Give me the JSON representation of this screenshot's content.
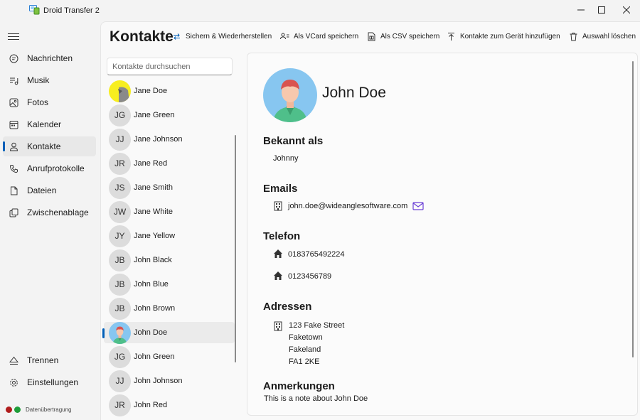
{
  "window": {
    "title": "Droid Transfer 2",
    "controls": [
      "minimize",
      "maximize",
      "close"
    ]
  },
  "nav": {
    "items": [
      {
        "label": "Nachrichten",
        "icon": "message-icon"
      },
      {
        "label": "Musik",
        "icon": "music-icon"
      },
      {
        "label": "Fotos",
        "icon": "photo-icon"
      },
      {
        "label": "Kalender",
        "icon": "calendar-icon"
      },
      {
        "label": "Kontakte",
        "icon": "person-icon",
        "active": true
      },
      {
        "label": "Anrufprotokolle",
        "icon": "phone-icon"
      },
      {
        "label": "Dateien",
        "icon": "file-icon"
      },
      {
        "label": "Zwischenablage",
        "icon": "clipboard-icon"
      }
    ],
    "bottom": [
      {
        "label": "Trennen",
        "icon": "eject-icon"
      },
      {
        "label": "Einstellungen",
        "icon": "gear-icon"
      }
    ],
    "status": {
      "label": "Datenübertragung",
      "colors": [
        "#b01c1c",
        "#1f9d3a"
      ]
    }
  },
  "page": {
    "title": "Kontakte"
  },
  "toolbar": {
    "backup": "Sichern & Wiederherstellen",
    "vcard": "Als VCard speichern",
    "csv": "Als CSV speichern",
    "add": "Kontakte zum Gerät hinzufügen",
    "delete": "Auswahl löschen"
  },
  "search": {
    "placeholder": "Kontakte durchsuchen",
    "value": ""
  },
  "contacts": [
    {
      "initials": "",
      "name": "Jane Doe",
      "photo": "yellow"
    },
    {
      "initials": "JG",
      "name": "Jane Green"
    },
    {
      "initials": "JJ",
      "name": "Jane Johnson"
    },
    {
      "initials": "JR",
      "name": "Jane Red"
    },
    {
      "initials": "JS",
      "name": "Jane Smith"
    },
    {
      "initials": "JW",
      "name": "Jane White"
    },
    {
      "initials": "JY",
      "name": "Jane Yellow"
    },
    {
      "initials": "JB",
      "name": "John Black"
    },
    {
      "initials": "JB",
      "name": "John Blue"
    },
    {
      "initials": "JB",
      "name": "John Brown"
    },
    {
      "initials": "",
      "name": "John Doe",
      "photo": "avatar",
      "selected": true
    },
    {
      "initials": "JG",
      "name": "John Green"
    },
    {
      "initials": "JJ",
      "name": "John Johnson"
    },
    {
      "initials": "JR",
      "name": "John Red"
    }
  ],
  "detail": {
    "name": "John Doe",
    "known_as_title": "Bekannt als",
    "known_as": "Johnny",
    "emails_title": "Emails",
    "email": "john.doe@wideanglesoftware.com",
    "phone_title": "Telefon",
    "phones": [
      "0183765492224",
      "0123456789"
    ],
    "address_title": "Adressen",
    "address_lines": [
      "123 Fake Street",
      "Faketown",
      "Fakeland",
      "FA1 2KE"
    ],
    "notes_title": "Anmerkungen",
    "note": "This is a note about John Doe"
  },
  "colors": {
    "accent": "#005fb8",
    "avatar_bg": "#87c6f0",
    "email_icon": "#6b3fd6"
  }
}
